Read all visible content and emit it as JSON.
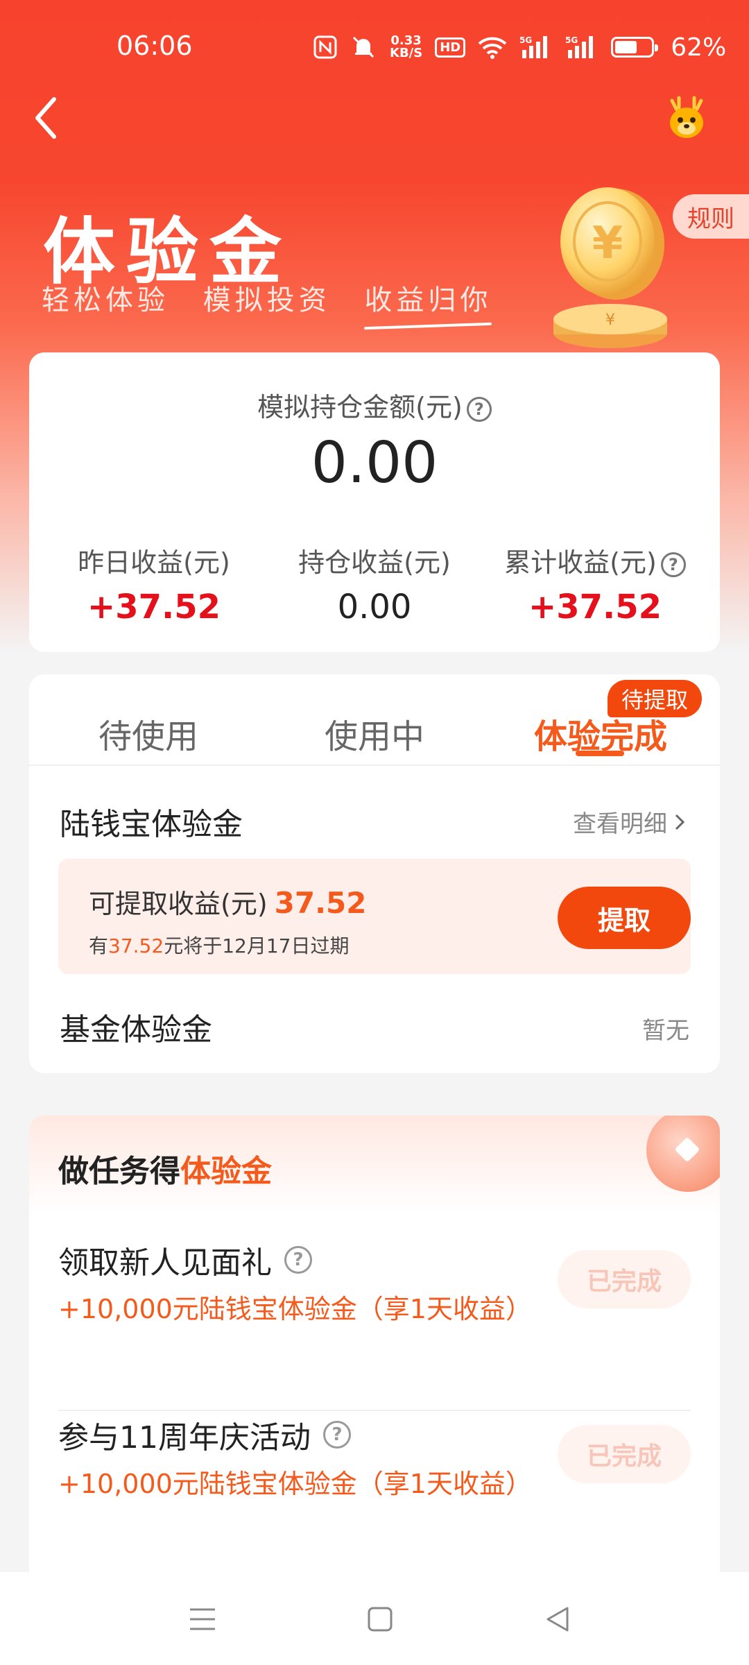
{
  "status_bar": {
    "time": "06:06",
    "speed_value": "0.33",
    "speed_unit": "KB/S",
    "hd_label": "HD",
    "signal_label_1": "5G",
    "signal_label_2": "5G",
    "battery_percent": "62%",
    "battery_level": 0.62
  },
  "header": {
    "back_icon": "chevron-left-icon",
    "mascot_icon": "deer-mascot-icon"
  },
  "hero": {
    "title": "体验金",
    "subtitle_1": "轻松体验",
    "subtitle_2": "模拟投资",
    "subtitle_3": "收益归你",
    "rules_label": "规则"
  },
  "summary": {
    "label": "模拟持仓金额(元)",
    "value": "0.00",
    "stats": [
      {
        "label": "昨日收益(元)",
        "value": "+37.52"
      },
      {
        "label": "持仓收益(元)",
        "value": "0.00"
      },
      {
        "label": "累计收益(元)",
        "value": "+37.52"
      }
    ]
  },
  "tabs": {
    "items": [
      {
        "label": "待使用"
      },
      {
        "label": "使用中"
      },
      {
        "label": "体验完成"
      }
    ],
    "badge": "待提取"
  },
  "lqb": {
    "title": "陆钱宝体验金",
    "detail_link": "查看明细",
    "withdrawable_label": "可提取收益(元)",
    "withdrawable_amount": "37.52",
    "expire_prefix": "有",
    "expire_amount": "37.52",
    "expire_suffix": "元将于12月17日过期",
    "withdraw_button": "提取"
  },
  "fund": {
    "title": "基金体验金",
    "status": "暂无"
  },
  "tasks": {
    "title_prefix": "做任务得",
    "title_highlight": "体验金",
    "items": [
      {
        "title": "领取新人见面礼",
        "reward": "+10,000元陆钱宝体验金（享1天收益）",
        "button": "已完成"
      },
      {
        "title": "参与11周年庆活动",
        "reward": "+10,000元陆钱宝体验金（享1天收益）",
        "button": "已完成"
      }
    ]
  },
  "colors": {
    "brand_red": "#f7432d",
    "accent_orange": "#f45a1c",
    "gain_red": "#e4101c"
  }
}
